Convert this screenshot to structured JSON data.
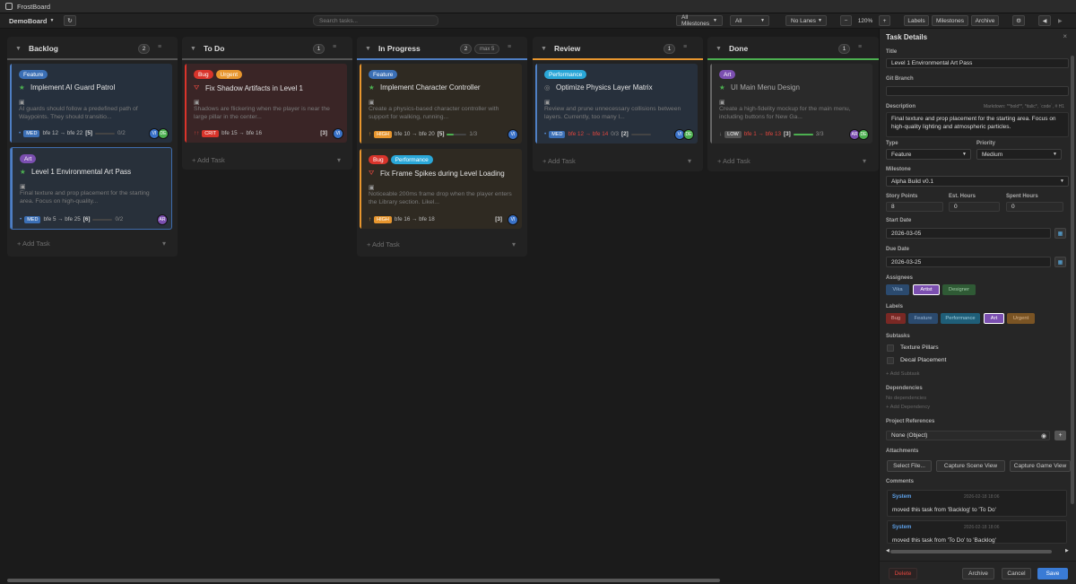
{
  "app": {
    "title": "FrostBoard"
  },
  "toolbar": {
    "board": "DemoBoard",
    "search_placeholder": "Search tasks...",
    "milestones": "All Milestones",
    "filter": "All",
    "lanes": "No Lanes",
    "zoom": "120%",
    "minus": "−",
    "plus": "+",
    "labels_btn": "Labels",
    "milestones_btn": "Milestones",
    "archive_btn": "Archive"
  },
  "columns": [
    {
      "name": "Backlog",
      "count": "2",
      "color": "#555555"
    },
    {
      "name": "To Do",
      "count": "1",
      "color": "#555555"
    },
    {
      "name": "In Progress",
      "count": "2",
      "max": "max 5",
      "color": "#4f7fc4"
    },
    {
      "name": "Review",
      "count": "1",
      "color": "#e8962e"
    },
    {
      "name": "Done",
      "count": "1",
      "color": "#4caf50"
    }
  ],
  "add_task": "+ Add Task",
  "cards": [
    {
      "tags": [
        "Feature"
      ],
      "icon": "★",
      "title": "Implement AI Guard Patrol",
      "desc": "AI guards should follow a predefined path of Waypoints. They should transitio...",
      "prio": "MED",
      "deps": "bfe 12 → bfe 22",
      "att": "[5]",
      "chk": "0/2",
      "progress": 0,
      "avatars": [
        "VI",
        "DE"
      ]
    },
    {
      "tags": [
        "Art"
      ],
      "icon": "★",
      "title": "Level 1 Environmental Art Pass",
      "desc": "Final texture and prop placement for the starting area. Focus on high-quality...",
      "prio": "MED",
      "deps": "bfe 5 → bfe 25",
      "att": "[6]",
      "chk": "0/2",
      "progress": 0,
      "avatars": [
        "AR"
      ]
    },
    {
      "tags": [
        "Bug",
        "Urgent"
      ],
      "icon": "⛛",
      "title": "Fix Shadow Artifacts in Level 1",
      "desc": "Shadows are flickering when the player is near the large pillar in the center...",
      "prio": "CRIT",
      "deps": "bfe 15 → bfe 16",
      "att": "[3]",
      "avatars": [
        "VI"
      ]
    },
    {
      "tags": [
        "Feature"
      ],
      "icon": "★",
      "title": "Implement Character Controller",
      "desc": "Create a physics-based character controller with support for walking, running...",
      "prio": "HIGH",
      "deps": "bfe 10 → bfe 20",
      "att": "[5]",
      "chk": "1/3",
      "progress": 0.33,
      "avatars": [
        "VI"
      ]
    },
    {
      "tags": [
        "Bug",
        "Performance"
      ],
      "icon": "⛛",
      "title": "Fix Frame Spikes during Level Loading",
      "desc": "Noticeable 200ms frame drop when the player enters the Library section. Likel...",
      "prio": "HIGH",
      "deps": "bfe 16 → bfe 18",
      "att": "[3]",
      "avatars": [
        "VI"
      ]
    },
    {
      "tags": [
        "Performance"
      ],
      "icon": "◎",
      "title": "Optimize Physics Layer Matrix",
      "desc": "Review and prune unnecessary collisions between layers. Currently, too many l...",
      "prio": "MED",
      "deps": "bfe 12 → bfe 14",
      "att": "[2]",
      "chk": "0/3",
      "progress": 0,
      "avatars": [
        "VI",
        "DE"
      ]
    },
    {
      "tags": [
        "Art"
      ],
      "icon": "★",
      "title": "UI Main Menu Design",
      "desc": "Create a high-fidelity mockup for the main menu, including buttons for New Ga...",
      "prio": "LOW",
      "deps": "bfe 1 → bfe 13",
      "att": "[3]",
      "chk": "3/3",
      "progress": 1,
      "avatars": [
        "AR",
        "DE"
      ]
    }
  ],
  "panel": {
    "title": "Task Details",
    "close": "×",
    "title_label": "Title",
    "title_value": "Level 1 Environmental Art Pass",
    "git_label": "Git Branch",
    "git_value": "",
    "desc_label": "Description",
    "desc_hint": "Markdown: **bold**, *italic*, `code`, # H1",
    "desc_value": "Final texture and prop placement for the starting area. Focus on high-quality lighting and atmospheric particles.",
    "type_label": "Type",
    "type_value": "Feature",
    "priority_label": "Priority",
    "priority_value": "Medium",
    "milestone_label": "Milestone",
    "milestone_value": "Alpha Build v0.1",
    "sp_label": "Story Points",
    "sp_value": "8",
    "est_label": "Est. Hours",
    "est_value": "0",
    "spent_label": "Spent Hours",
    "spent_value": "0",
    "start_label": "Start Date",
    "start_value": "2026-03-05",
    "due_label": "Due Date",
    "due_value": "2026-03-25",
    "assignees_label": "Assignees",
    "assignees": [
      "Vika",
      "Artist",
      "Designer"
    ],
    "labels_label": "Labels",
    "labels": [
      "Bug",
      "Feature",
      "Performance",
      "Art",
      "Urgent"
    ],
    "subtasks_label": "Subtasks",
    "subtasks": [
      "Texture Pillars",
      "Decal Placement"
    ],
    "add_subtask": "+ Add Subtask",
    "deps_label": "Dependencies",
    "no_deps": "No dependencies",
    "add_dep": "+ Add Dependency",
    "refs_label": "Project References",
    "refs_value": "None (Object)",
    "attach_label": "Attachments",
    "attach_btns": [
      "Select File...",
      "Capture Scene View",
      "Capture Game View"
    ],
    "comments_label": "Comments",
    "comments": [
      {
        "author": "System",
        "time": "2026-02-18 18:06",
        "text": "moved this task from 'Backlog' to 'To Do'"
      },
      {
        "author": "System",
        "time": "2026-02-18 18:06",
        "text": "moved this task from 'To Do' to 'Backlog'"
      }
    ],
    "delete": "Delete",
    "archive": "Archive",
    "cancel": "Cancel",
    "save": "Save"
  },
  "colors": {
    "feature": "#3b6fb5",
    "art": "#7b4fb0",
    "bug": "#d9342b",
    "urgent": "#e8962e",
    "performance": "#2aa7d8"
  }
}
